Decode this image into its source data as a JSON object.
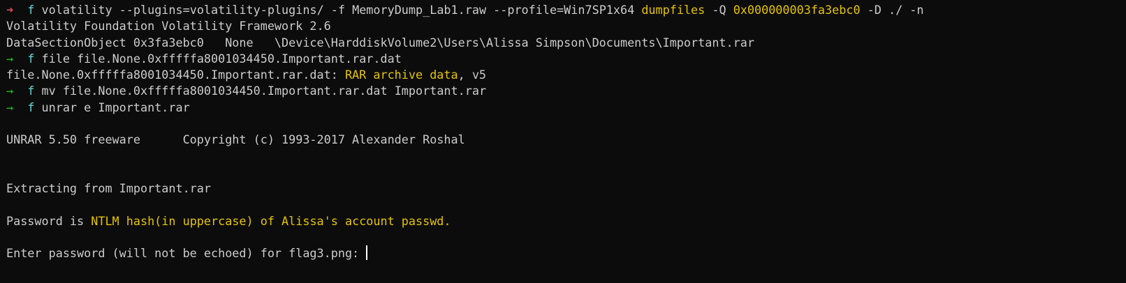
{
  "colors": {
    "background": "#0c0c0c",
    "default_text": "#cccccc",
    "prompt_error": "#e74856",
    "prompt_ok": "#16c60c",
    "prompt_dir": "#61d6d6",
    "highlight": "#e5c400"
  },
  "terminal": {
    "lines": [
      {
        "type": "command",
        "status": "error",
        "arrow": "➜",
        "dir": "f",
        "segments": [
          {
            "text": "volatility --plugins=volatility-plugins/ -f MemoryDump_Lab1.raw --profile=Win7SP1x64 ",
            "style": "text"
          },
          {
            "text": "dumpfiles",
            "style": "gold"
          },
          {
            "text": " -Q ",
            "style": "text"
          },
          {
            "text": "0x000000003fa3ebc0",
            "style": "gold"
          },
          {
            "text": " -D ./ -n",
            "style": "text"
          }
        ]
      },
      {
        "type": "output",
        "segments": [
          {
            "text": "Volatility Foundation Volatility Framework 2.6",
            "style": "text"
          }
        ]
      },
      {
        "type": "output",
        "segments": [
          {
            "text": "DataSectionObject 0x3fa3ebc0   None   \\Device\\HarddiskVolume2\\Users\\Alissa Simpson\\Documents\\Important.rar",
            "style": "text"
          }
        ]
      },
      {
        "type": "command",
        "status": "ok",
        "arrow": "→",
        "dir": "f",
        "segments": [
          {
            "text": "file file.None.0xfffffa8001034450.Important.rar.dat",
            "style": "text"
          }
        ]
      },
      {
        "type": "output",
        "segments": [
          {
            "text": "file.None.0xfffffa8001034450.Important.rar.dat: ",
            "style": "text"
          },
          {
            "text": "RAR archive data",
            "style": "gold"
          },
          {
            "text": ", v5",
            "style": "text"
          }
        ]
      },
      {
        "type": "command",
        "status": "ok",
        "arrow": "→",
        "dir": "f",
        "segments": [
          {
            "text": "mv file.None.0xfffffa8001034450.Important.rar.dat Important.rar",
            "style": "text"
          }
        ]
      },
      {
        "type": "command",
        "status": "ok",
        "arrow": "→",
        "dir": "f",
        "segments": [
          {
            "text": "unrar e Important.rar",
            "style": "text"
          }
        ]
      },
      {
        "type": "blank",
        "segments": []
      },
      {
        "type": "output",
        "segments": [
          {
            "text": "UNRAR 5.50 freeware      Copyright (c) 1993-2017 Alexander Roshal",
            "style": "text"
          }
        ]
      },
      {
        "type": "blank",
        "segments": []
      },
      {
        "type": "blank",
        "segments": []
      },
      {
        "type": "output",
        "segments": [
          {
            "text": "Extracting from Important.rar",
            "style": "text"
          }
        ]
      },
      {
        "type": "blank",
        "segments": []
      },
      {
        "type": "output",
        "segments": [
          {
            "text": "Password is ",
            "style": "text"
          },
          {
            "text": "NTLM hash(in uppercase) of Alissa's account passwd.",
            "style": "gold"
          }
        ]
      },
      {
        "type": "blank",
        "segments": []
      },
      {
        "type": "input",
        "segments": [
          {
            "text": "Enter password (will not be echoed) for flag3.png: ",
            "style": "text"
          }
        ],
        "cursor": true
      }
    ]
  }
}
